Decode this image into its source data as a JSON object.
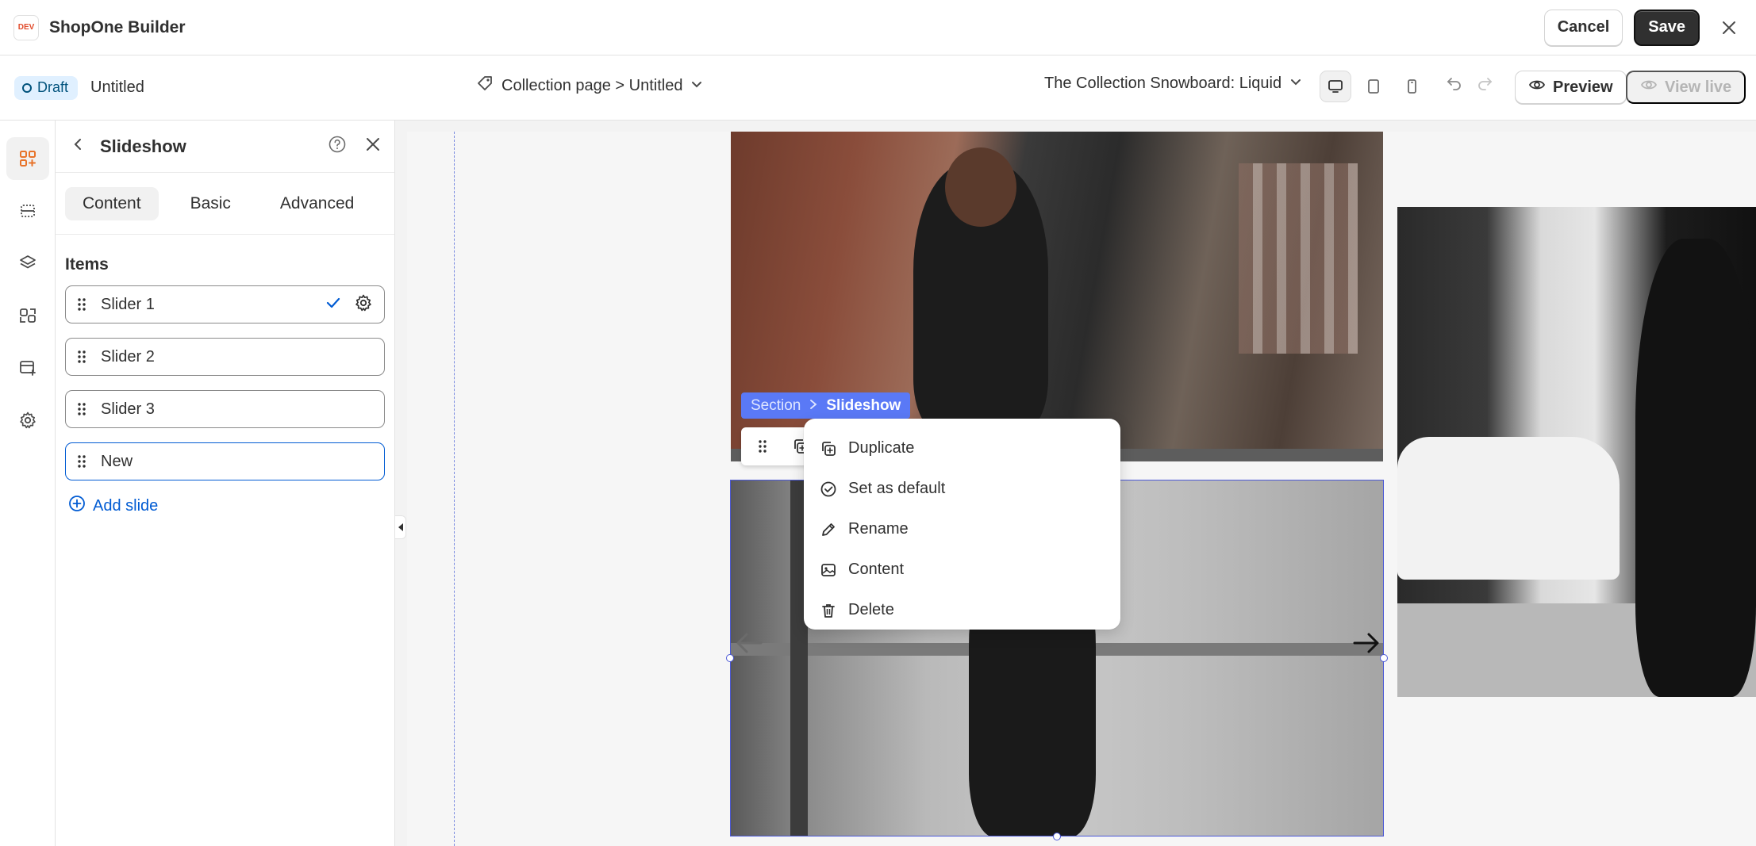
{
  "app": {
    "title": "ShopOne Builder",
    "logo_text": "DEV"
  },
  "topbar": {
    "cancel_label": "Cancel",
    "save_label": "Save"
  },
  "subbar": {
    "status": "Draft",
    "page_name": "Untitled",
    "page_selector": "Collection page > Untitled",
    "template_selector": "The Collection Snowboard: Liquid",
    "preview_label": "Preview",
    "view_live_label": "View live"
  },
  "panel": {
    "title": "Slideshow",
    "tabs": [
      {
        "label": "Content",
        "active": true
      },
      {
        "label": "Basic",
        "active": false
      },
      {
        "label": "Advanced",
        "active": false
      }
    ],
    "items_label": "Items",
    "slides": [
      {
        "label": "Slider 1"
      },
      {
        "label": "Slider 2"
      },
      {
        "label": "Slider 3"
      },
      {
        "label": "New"
      }
    ],
    "add_slide_label": "Add slide"
  },
  "canvas": {
    "breadcrumb": {
      "parent": "Section",
      "current": "Slideshow"
    }
  },
  "context_menu": {
    "items": [
      {
        "label": "Duplicate",
        "icon": "duplicate-icon"
      },
      {
        "label": "Set as default",
        "icon": "check-circle-icon"
      },
      {
        "label": "Rename",
        "icon": "pencil-icon"
      },
      {
        "label": "Content",
        "icon": "image-content-icon"
      },
      {
        "label": "Delete",
        "icon": "trash-icon"
      }
    ]
  },
  "colors": {
    "accent_blue": "#005bd3",
    "selection_blue": "#5a79f6",
    "primary_dark": "#303030",
    "draft_badge_bg": "#e0f0ff"
  }
}
